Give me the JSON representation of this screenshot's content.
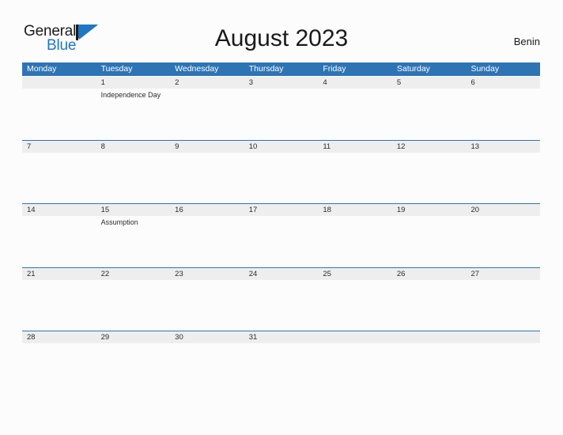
{
  "brand": {
    "word_one": "General",
    "word_two": "Blue",
    "triangle_icon": "triangle-right-icon",
    "color_dark": "#1a1a1a",
    "color_blue": "#1f76c2"
  },
  "header": {
    "title": "August 2023",
    "country": "Benin"
  },
  "theme": {
    "accent": "#2e74b5",
    "number_band": "#eeeeee",
    "page_background": "#fcfcfc",
    "text": "#2b2b2b"
  },
  "calendar": {
    "weekdays": [
      "Monday",
      "Tuesday",
      "Wednesday",
      "Thursday",
      "Friday",
      "Saturday",
      "Sunday"
    ],
    "weeks": [
      [
        {
          "num": "",
          "events": []
        },
        {
          "num": "1",
          "events": [
            "Independence Day"
          ]
        },
        {
          "num": "2",
          "events": []
        },
        {
          "num": "3",
          "events": []
        },
        {
          "num": "4",
          "events": []
        },
        {
          "num": "5",
          "events": []
        },
        {
          "num": "6",
          "events": []
        }
      ],
      [
        {
          "num": "7",
          "events": []
        },
        {
          "num": "8",
          "events": []
        },
        {
          "num": "9",
          "events": []
        },
        {
          "num": "10",
          "events": []
        },
        {
          "num": "11",
          "events": []
        },
        {
          "num": "12",
          "events": []
        },
        {
          "num": "13",
          "events": []
        }
      ],
      [
        {
          "num": "14",
          "events": []
        },
        {
          "num": "15",
          "events": [
            "Assumption"
          ]
        },
        {
          "num": "16",
          "events": []
        },
        {
          "num": "17",
          "events": []
        },
        {
          "num": "18",
          "events": []
        },
        {
          "num": "19",
          "events": []
        },
        {
          "num": "20",
          "events": []
        }
      ],
      [
        {
          "num": "21",
          "events": []
        },
        {
          "num": "22",
          "events": []
        },
        {
          "num": "23",
          "events": []
        },
        {
          "num": "24",
          "events": []
        },
        {
          "num": "25",
          "events": []
        },
        {
          "num": "26",
          "events": []
        },
        {
          "num": "27",
          "events": []
        }
      ],
      [
        {
          "num": "28",
          "events": []
        },
        {
          "num": "29",
          "events": []
        },
        {
          "num": "30",
          "events": []
        },
        {
          "num": "31",
          "events": []
        },
        {
          "num": "",
          "events": []
        },
        {
          "num": "",
          "events": []
        },
        {
          "num": "",
          "events": []
        }
      ]
    ]
  }
}
